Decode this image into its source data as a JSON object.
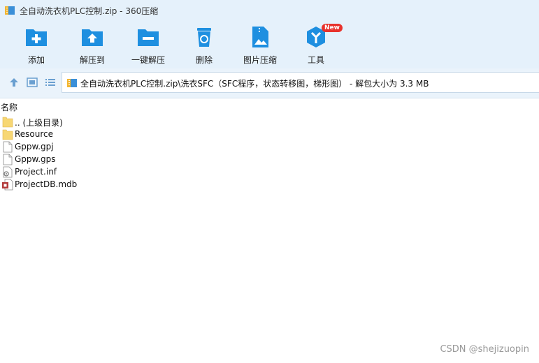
{
  "window": {
    "title": "全自动洗衣机PLC控制.zip - 360压缩"
  },
  "toolbar": {
    "buttons": [
      {
        "label": "添加",
        "icon": "add-folder-icon"
      },
      {
        "label": "解压到",
        "icon": "extract-folder-icon"
      },
      {
        "label": "一键解压",
        "icon": "one-click-extract-icon"
      },
      {
        "label": "删除",
        "icon": "delete-bin-icon"
      },
      {
        "label": "图片压缩",
        "icon": "image-compress-icon"
      },
      {
        "label": "工具",
        "icon": "tools-cube-icon",
        "badge": "New"
      }
    ]
  },
  "address": {
    "path": "全自动洗衣机PLC控制.zip\\洗衣SFC（SFC程序，状态转移图，梯形图） - 解包大小为 3.3 MB"
  },
  "list": {
    "column_name": "名称",
    "files": [
      {
        "name": ".. (上级目录)",
        "type": "folder"
      },
      {
        "name": "Resource",
        "type": "folder"
      },
      {
        "name": "Gppw.gpj",
        "type": "file"
      },
      {
        "name": "Gppw.gps",
        "type": "file"
      },
      {
        "name": "Project.inf",
        "type": "config"
      },
      {
        "name": "ProjectDB.mdb",
        "type": "database"
      }
    ]
  },
  "watermark": "CSDN @shejizuopin",
  "colors": {
    "accent": "#1e8fe0",
    "toolbar_bg": "#e5f1fb",
    "badge": "#e8322c",
    "folder": "#f7d774"
  }
}
